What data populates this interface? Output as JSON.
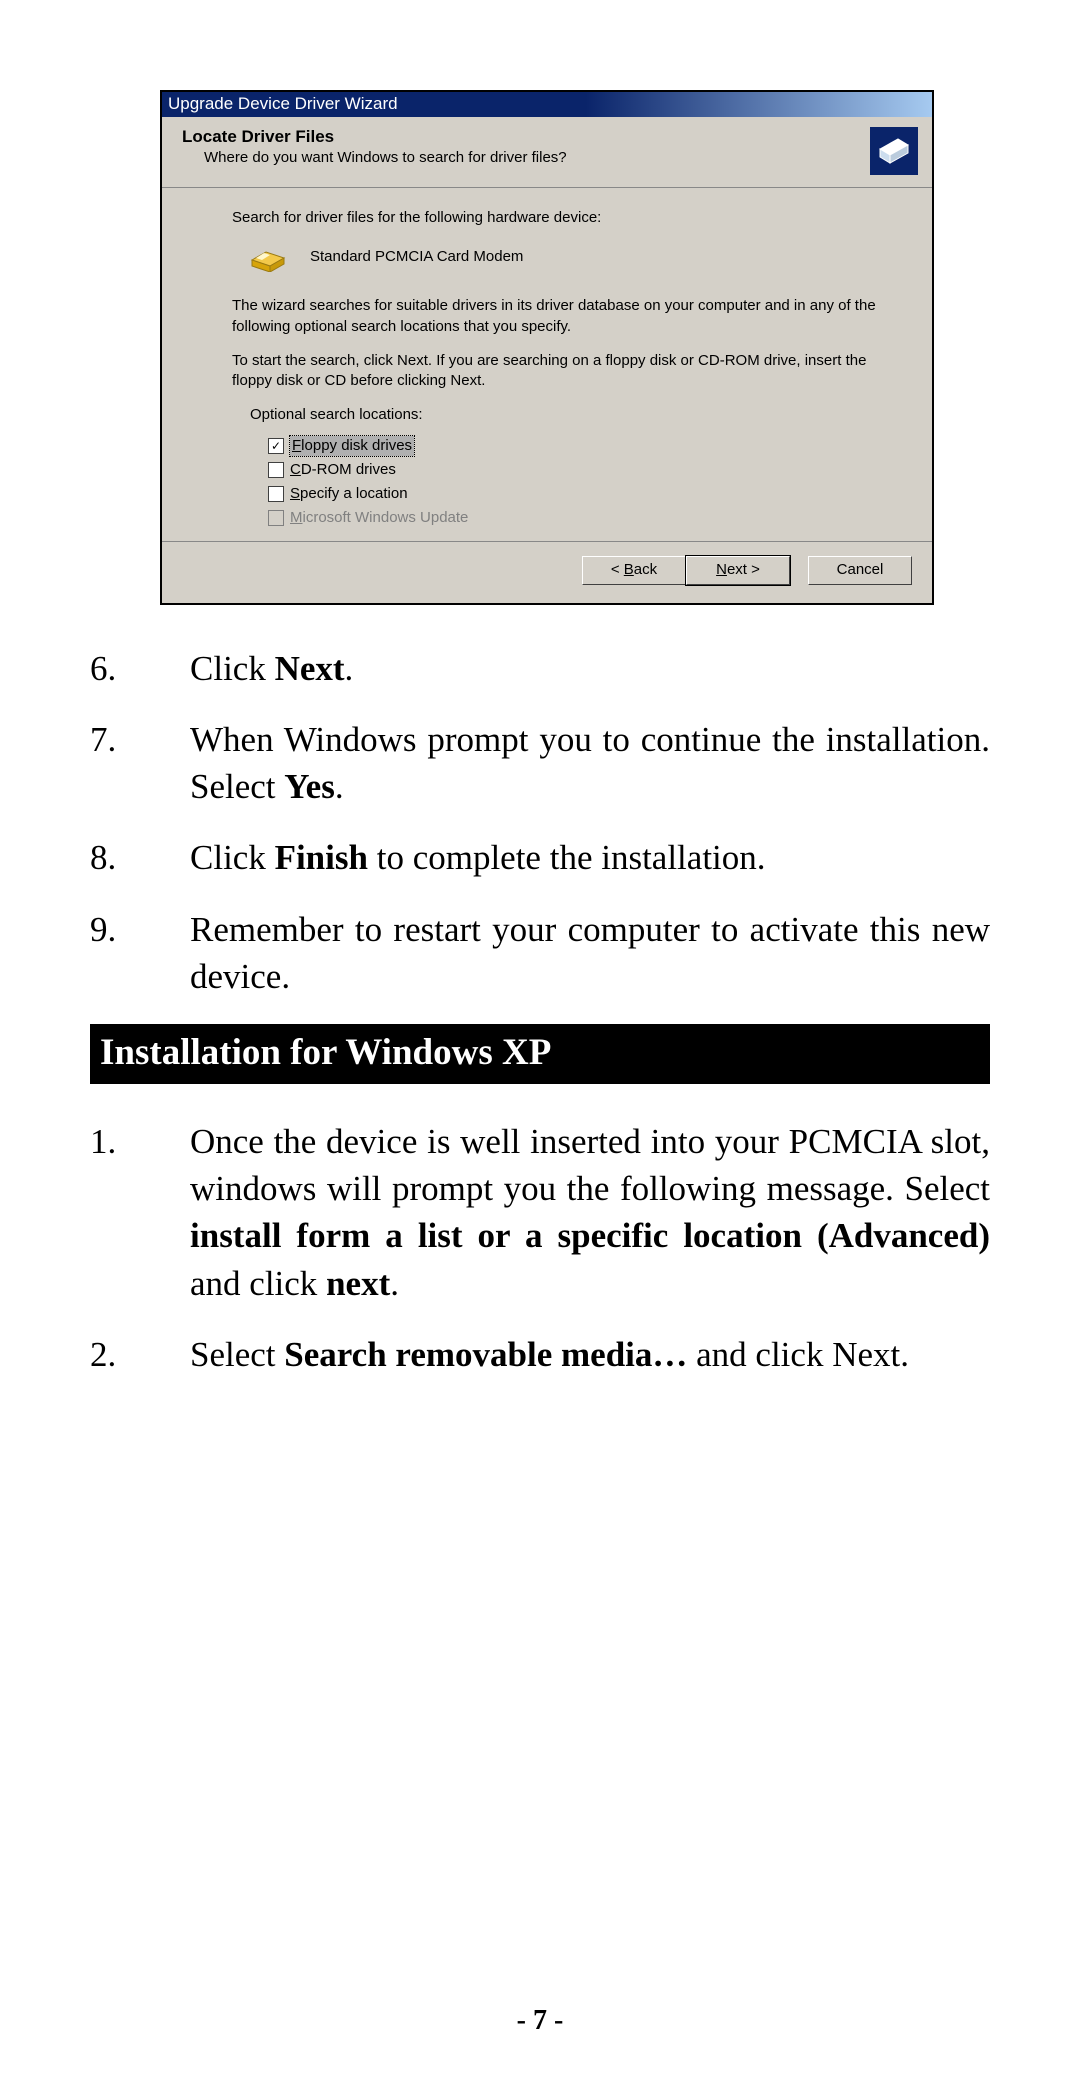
{
  "wizard": {
    "title": "Upgrade Device Driver Wizard",
    "head_title": "Locate Driver Files",
    "head_sub": "Where do you want Windows to search for driver files?",
    "body_search_for": "Search for driver files for the following hardware device:",
    "device_name": "Standard PCMCIA Card Modem",
    "para1": "The wizard searches for suitable drivers in its driver database on your computer and in any of the following optional search locations that you specify.",
    "para2": "To start the search, click Next. If you are searching on a floppy disk or CD-ROM drive, insert the floppy disk or CD before clicking Next.",
    "opt_label": "Optional search locations:",
    "options": [
      {
        "key": "F",
        "rest": "loppy disk drives",
        "checked": true,
        "selected": true,
        "disabled": false
      },
      {
        "key": "C",
        "rest": "D-ROM drives",
        "checked": false,
        "selected": false,
        "disabled": false
      },
      {
        "key": "S",
        "rest": "pecify a location",
        "checked": false,
        "selected": false,
        "disabled": false
      },
      {
        "key": "M",
        "rest": "icrosoft Windows Update",
        "checked": false,
        "selected": false,
        "disabled": true
      }
    ],
    "buttons": {
      "back_key": "B",
      "back_rest_pre": "< ",
      "back_rest_post": "ack",
      "next_key": "N",
      "next_rest": "ext >",
      "cancel": "Cancel"
    }
  },
  "doc": {
    "list_a": [
      {
        "n": "6.",
        "html": "Click <b>Next</b>."
      },
      {
        "n": "7.",
        "html": "When Windows prompt you to continue the installation.  Select <b>Yes</b>."
      },
      {
        "n": "8.",
        "html": "Click <b>Finish</b> to complete the installation."
      },
      {
        "n": "9.",
        "html": "Remember to restart your computer to activate this new device."
      }
    ],
    "section_head": "Installation for Windows XP",
    "list_b": [
      {
        "n": "1.",
        "html": "Once the device is well inserted into your PCMCIA slot, windows will prompt you the following message.  Select <b>install form a list or a specific location (Advanced)</b> and click <b>next</b>."
      },
      {
        "n": "2.",
        "html": "Select <b>Search removable media…</b> and click Next."
      }
    ],
    "page_number": "- 7 -"
  }
}
